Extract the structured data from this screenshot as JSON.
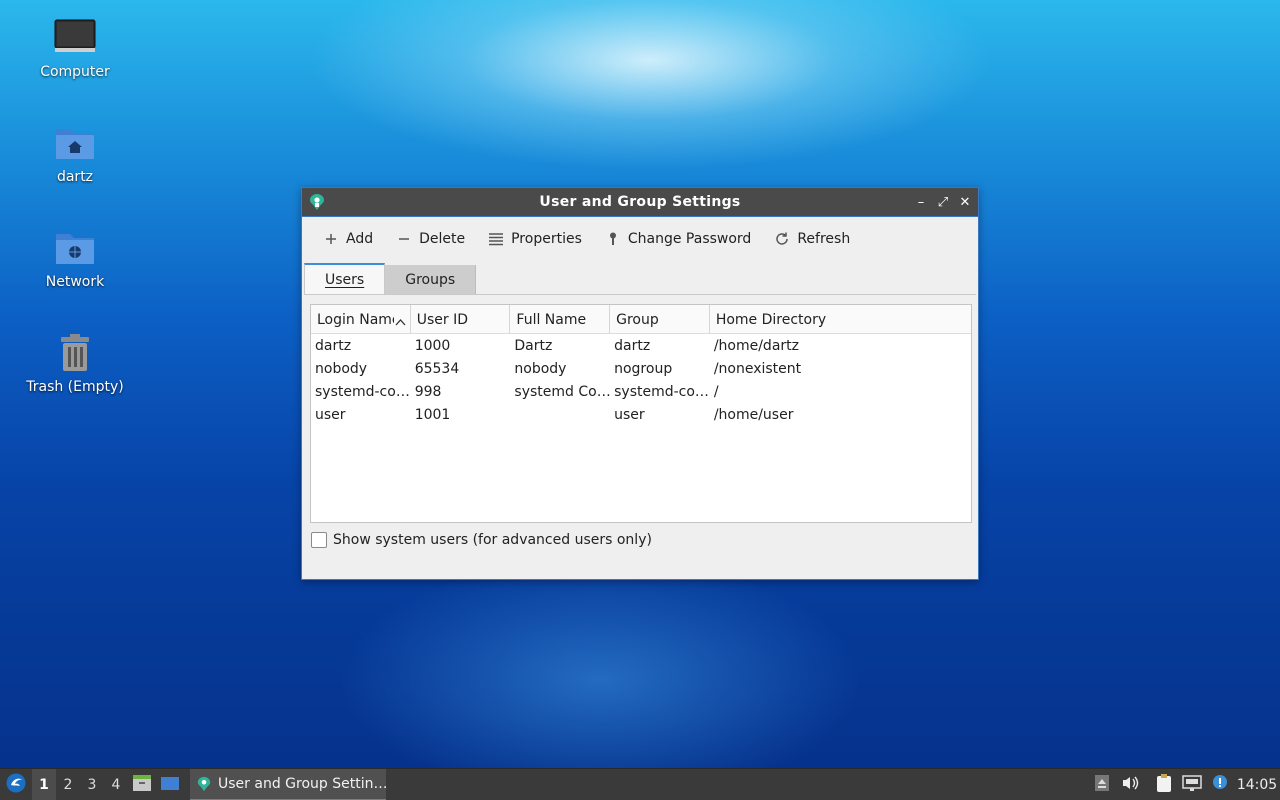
{
  "desktop": {
    "icons": [
      {
        "label": "Computer"
      },
      {
        "label": "dartz"
      },
      {
        "label": "Network"
      },
      {
        "label": "Trash (Empty)"
      }
    ]
  },
  "window": {
    "title": "User and Group Settings",
    "controls": {
      "minimize": "–",
      "maximize": "⤢",
      "close": "✕"
    },
    "toolbar": {
      "add": "Add",
      "delete": "Delete",
      "properties": "Properties",
      "change_password": "Change Password",
      "refresh": "Refresh"
    },
    "tabs": [
      {
        "label": "Users",
        "active": true
      },
      {
        "label": "Groups",
        "active": false
      }
    ],
    "columns": [
      "Login Name",
      "User ID",
      "Full Name",
      "Group",
      "Home Directory"
    ],
    "rows": [
      {
        "login": "dartz",
        "uid": "1000",
        "full_name": "Dartz",
        "group": "dartz",
        "home": "/home/dartz"
      },
      {
        "login": "nobody",
        "uid": "65534",
        "full_name": "nobody",
        "group": "nogroup",
        "home": "/nonexistent"
      },
      {
        "login": "systemd-co…",
        "uid": "998",
        "full_name": "systemd Co…",
        "group": "systemd-co…",
        "home": "/"
      },
      {
        "login": "user",
        "uid": "1001",
        "full_name": "",
        "group": "user",
        "home": "/home/user"
      }
    ],
    "show_system_users": {
      "label": "Show system users (for advanced users only)",
      "checked": false
    }
  },
  "taskbar": {
    "workspaces": [
      "1",
      "2",
      "3",
      "4"
    ],
    "active_workspace": "1",
    "task_label": "User and Group Settin…",
    "clock": "14:05"
  },
  "colors": {
    "accent": "#3b8fd8",
    "titlebar": "#4a4a4a",
    "taskbar": "#3a3a3a"
  }
}
